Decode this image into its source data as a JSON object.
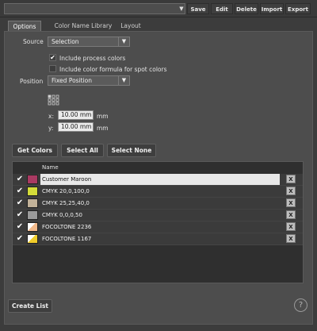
{
  "toolbar": {
    "save": "Save",
    "edit": "Edit",
    "delete": "Delete",
    "import": "Import",
    "export": "Export",
    "preset_value": ""
  },
  "tabs": [
    "Options",
    "Color Name Library",
    "Layout"
  ],
  "options": {
    "source_label": "Source",
    "source_value": "Selection",
    "include_process": "Include process colors",
    "include_process_checked": true,
    "include_formula": "Include color formula for spot colors",
    "include_formula_checked": false,
    "position_label": "Position",
    "position_value": "Fixed Position",
    "x_label": "x:",
    "x_value": "10.00 mm",
    "x_unit": "mm",
    "y_label": "y:",
    "y_value": "10.00 mm",
    "y_unit": "mm"
  },
  "buttons": {
    "get_colors": "Get Colors",
    "select_all": "Select All",
    "select_none": "Select None",
    "create_list": "Create List",
    "help": "?"
  },
  "table": {
    "header_name": "Name",
    "rows": [
      {
        "name": "Customer Maroon",
        "checked": true,
        "color": "#a93a62",
        "editing": true
      },
      {
        "name": "CMYK 20,0,100,0",
        "checked": true,
        "color": "#d4dc39"
      },
      {
        "name": "CMYK 25,25,40,0",
        "checked": true,
        "color": "#c2b299"
      },
      {
        "name": "CMYK 0,0,0,50",
        "checked": true,
        "color": "#9a9a9a"
      },
      {
        "name": "FOCOLTONE 2236",
        "checked": true,
        "color": "#f2b98a",
        "corner": "#ffffff"
      },
      {
        "name": "FOCOLTONE 1167",
        "checked": true,
        "color": "#f0cc2a",
        "corner": "#ffffff"
      }
    ],
    "delete_label": "X"
  }
}
